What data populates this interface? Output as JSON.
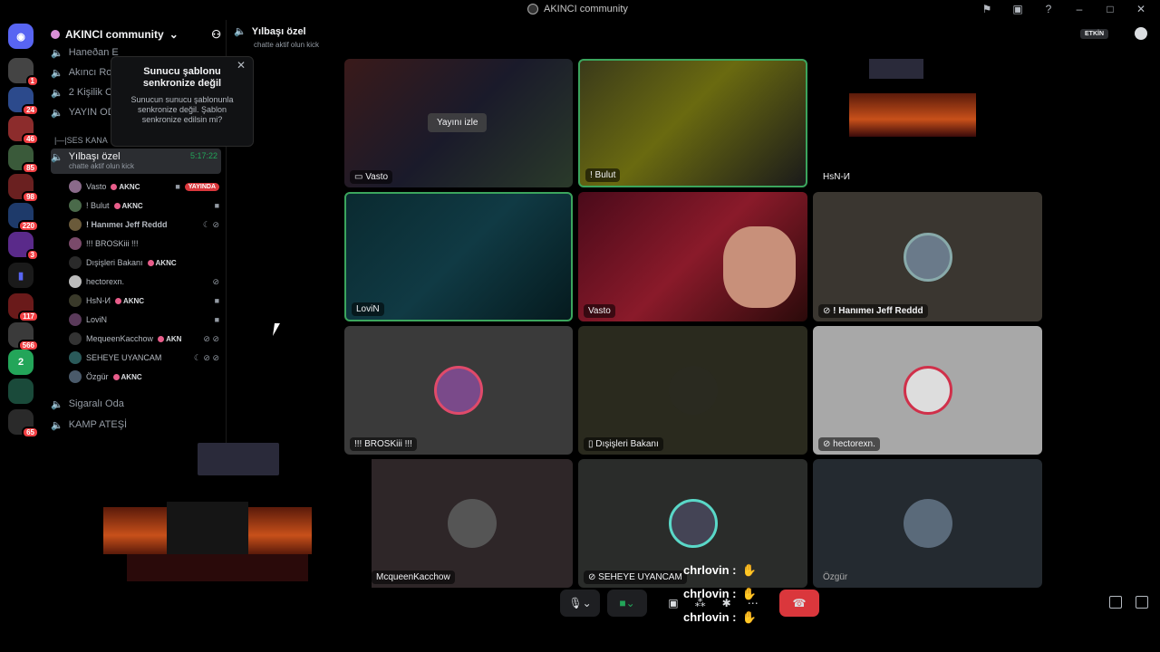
{
  "window": {
    "title": "AKINCI community"
  },
  "server": {
    "name": "AKINCI community",
    "rail_badges": [
      "1",
      "24",
      "46",
      "85",
      "98",
      "220",
      "3",
      "117",
      "566",
      "65"
    ]
  },
  "sidebar": {
    "channels_top": [
      "Haneðan E",
      "Akıncı Ro",
      "2 Kişilik C",
      "YAYIN OD"
    ],
    "category": "|—|SES KANA",
    "active_channel": {
      "name": "Yılbaşı özel",
      "subtitle": "chatte aktif olun kick",
      "time": "5:17:22"
    },
    "users": [
      {
        "name": "Vasto",
        "tag": "AKNC",
        "live": "YAYINDA"
      },
      {
        "name": "! Bulut",
        "tag": "AKNC"
      },
      {
        "name": "! Hanımeı Jeff Reddd",
        "tag": ""
      },
      {
        "name": "!!! BROSKiii !!!",
        "tag": ""
      },
      {
        "name": "Dışişleri Bakanı",
        "tag": "AKNC"
      },
      {
        "name": "hectorexn.",
        "tag": ""
      },
      {
        "name": "HsN-И",
        "tag": "AKNC"
      },
      {
        "name": "LoviN",
        "tag": ""
      },
      {
        "name": "MequeenKacchow",
        "tag": "AKN"
      },
      {
        "name": "SEHEYE UYANCAM",
        "tag": ""
      },
      {
        "name": "Özgür",
        "tag": "AKNC"
      }
    ],
    "channels_bottom": [
      "Sigaralı Oda",
      "KAMP ATEŞİ"
    ]
  },
  "tooltip": {
    "title": "Sunucu şablonu senkronize değil",
    "body": "Sunucun sunucu şablonunla senkronize değil. Şablon senkronize edilsin mi?"
  },
  "voice": {
    "channel_name": "Yılbaşı özel",
    "status": "chatte aktif olun kick",
    "etkin_label": "ETKİN"
  },
  "tiles": [
    {
      "label": "Vasto",
      "watch": "Yayını izle"
    },
    {
      "label": "! Bulut"
    },
    {
      "label": "HsN-И"
    },
    {
      "label": "LoviN"
    },
    {
      "label": "Vasto"
    },
    {
      "label": "! Hanımeı Jeff Reddd"
    },
    {
      "label": "!!! BROSKiii !!!"
    },
    {
      "label": "Dışişleri Bakanı"
    },
    {
      "label": "hectorexn."
    },
    {
      "label": "McqueenKacchow"
    },
    {
      "label": "SEHEYE UYANCAM"
    },
    {
      "label": "Özgür"
    }
  ],
  "chat_overlay": [
    "chrlovin :",
    "chrlovin :",
    "chrlovin :"
  ],
  "colors": {
    "accent_green": "#3ba55d",
    "danger_red": "#da373c",
    "bg": "#000000"
  }
}
